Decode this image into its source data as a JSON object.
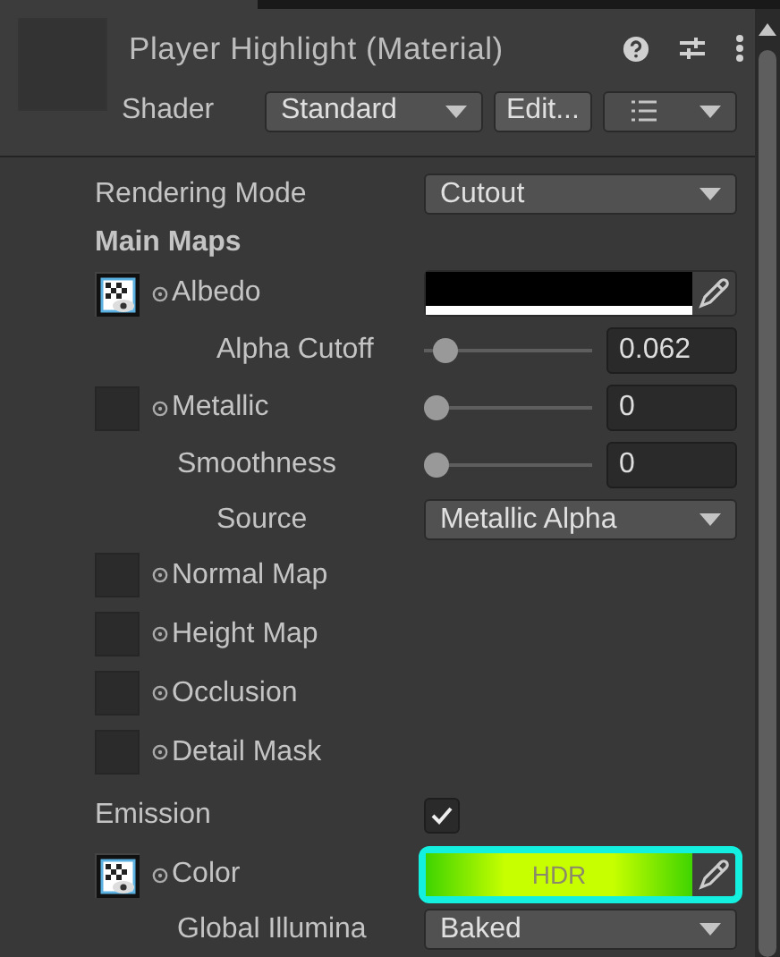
{
  "title": "Player Highlight (Material)",
  "shader": {
    "label": "Shader",
    "value": "Standard",
    "edit_button": "Edit..."
  },
  "properties": [
    {
      "kind": "dropdown",
      "label": "Rendering Mode",
      "value": "Cutout"
    },
    {
      "kind": "section",
      "label": "Main Maps"
    },
    {
      "kind": "texture_color",
      "label": "Albedo",
      "assigned": true,
      "color": "#000000",
      "level": 1
    },
    {
      "kind": "slider",
      "label": "Alpha Cutoff",
      "level": 0.062,
      "value": "0.062"
    },
    {
      "kind": "texture_slider",
      "label": "Metallic",
      "assigned": false,
      "level": 0,
      "value": "0"
    },
    {
      "kind": "slider",
      "label": "Smoothness",
      "level": 0,
      "value": "0"
    },
    {
      "kind": "dropdown",
      "label": "Source",
      "value": "Metallic Alpha"
    },
    {
      "kind": "texture",
      "label": "Normal Map",
      "assigned": false
    },
    {
      "kind": "texture",
      "label": "Height Map",
      "assigned": false
    },
    {
      "kind": "texture",
      "label": "Occlusion",
      "assigned": false
    },
    {
      "kind": "texture",
      "label": "Detail Mask",
      "assigned": false
    },
    {
      "kind": "checkbox",
      "label": "Emission",
      "checked": true
    },
    {
      "kind": "hdr_color",
      "label": "Color",
      "assigned": true,
      "color": "#c8ff00",
      "badge": "HDR",
      "highlighted": true
    },
    {
      "kind": "dropdown",
      "label": "Global Illumina",
      "value": "Baked"
    }
  ]
}
